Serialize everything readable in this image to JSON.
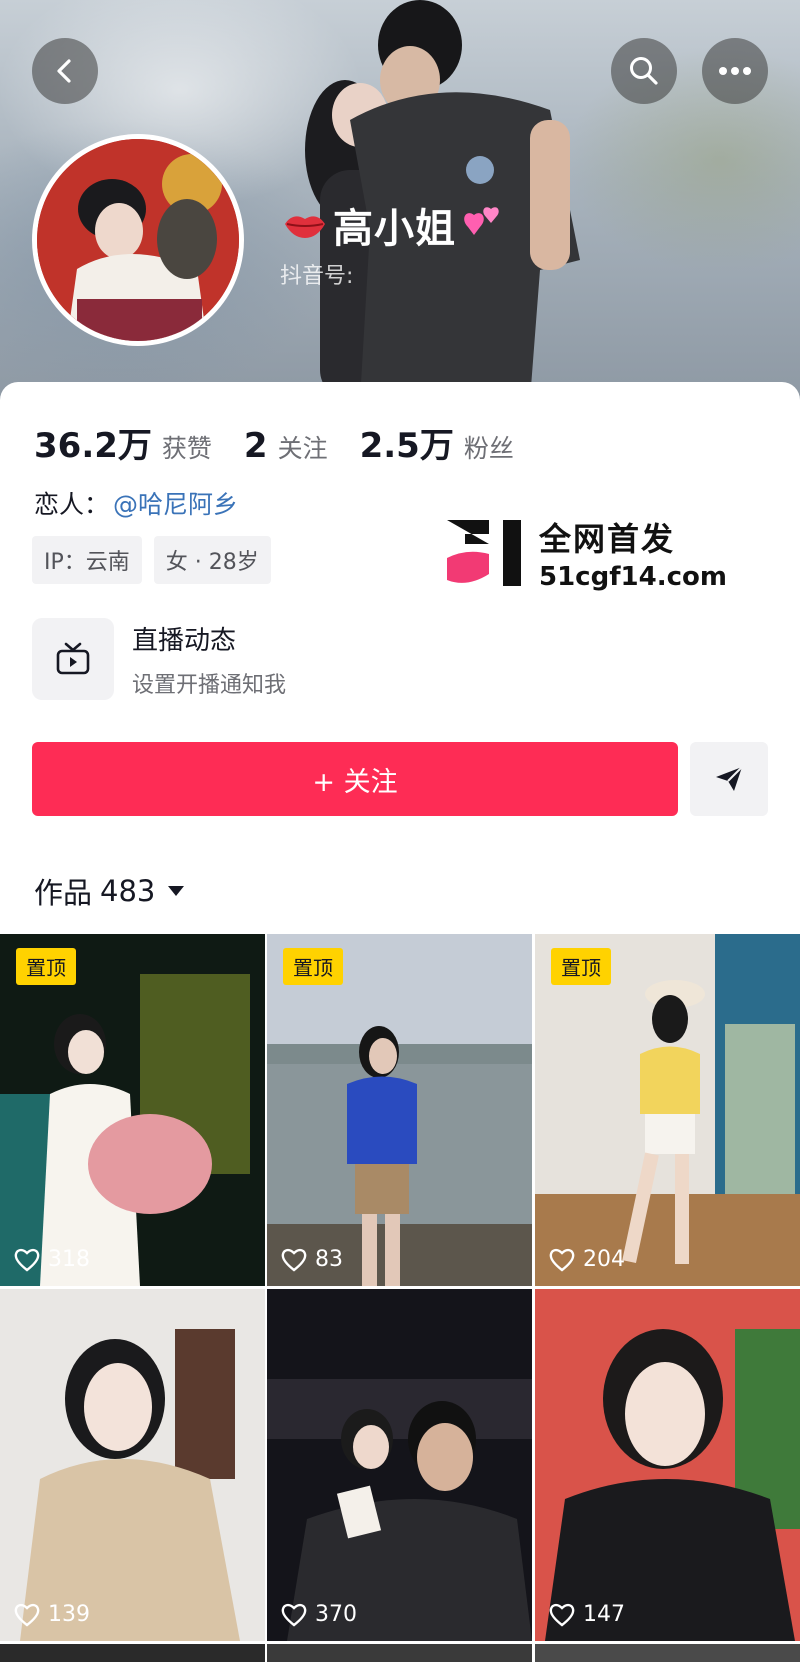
{
  "profile": {
    "nickname": "高小姐",
    "douyin_id_label": "抖音号:"
  },
  "stats": [
    {
      "value": "36.2万",
      "label": "获赞"
    },
    {
      "value": "2",
      "label": "关注"
    },
    {
      "value": "2.5万",
      "label": "粉丝"
    }
  ],
  "lover": {
    "label": "恋人：",
    "link": "@哈尼阿乡"
  },
  "tags": [
    "IP：云南",
    "女 · 28岁"
  ],
  "watermark": {
    "line1": "全网首发",
    "line2": "51cgf14.com"
  },
  "live": {
    "title": "直播动态",
    "subtitle": "设置开播通知我"
  },
  "follow_button": "+ 关注",
  "works": {
    "label": "作品",
    "count": "483"
  },
  "videos": [
    {
      "likes": "318",
      "pin": "置顶"
    },
    {
      "likes": "83",
      "pin": "置顶"
    },
    {
      "likes": "204",
      "pin": "置顶"
    },
    {
      "likes": "139"
    },
    {
      "likes": "370"
    },
    {
      "likes": "147"
    }
  ],
  "colors": {
    "accent": "#fe2c55",
    "pin": "#ffd200",
    "link": "#3a73b8"
  },
  "icons": [
    "back-icon",
    "search-icon",
    "more-icon",
    "lips-icon",
    "hearts-icon",
    "tv-icon",
    "share-icon",
    "caret-down-icon",
    "heart-icon"
  ]
}
